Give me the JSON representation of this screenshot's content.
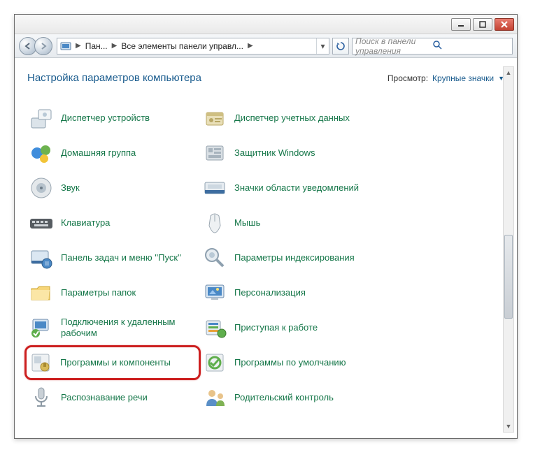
{
  "breadcrumb": {
    "seg1": "Пан...",
    "seg2": "Все элементы панели управл..."
  },
  "search": {
    "placeholder": "Поиск в панели управления"
  },
  "header": {
    "title": "Настройка параметров компьютера",
    "view_label": "Просмотр:",
    "view_value": "Крупные значки"
  },
  "left_items": [
    {
      "name": "device-manager",
      "label": "Диспетчер устройств",
      "icon": "device"
    },
    {
      "name": "homegroup",
      "label": "Домашняя группа",
      "icon": "homegroup"
    },
    {
      "name": "sound",
      "label": "Звук",
      "icon": "sound"
    },
    {
      "name": "keyboard",
      "label": "Клавиатура",
      "icon": "keyboard"
    },
    {
      "name": "taskbar-startmenu",
      "label": "Панель задач и меню ''Пуск''",
      "icon": "taskbar"
    },
    {
      "name": "folder-options",
      "label": "Параметры папок",
      "icon": "folder"
    },
    {
      "name": "remote-connections",
      "label": "Подключения к удаленным рабочим",
      "icon": "remote"
    },
    {
      "name": "programs-features",
      "label": "Программы и компоненты",
      "icon": "programs",
      "highlight": true
    },
    {
      "name": "speech-recognition",
      "label": "Распознавание речи",
      "icon": "mic"
    }
  ],
  "right_items": [
    {
      "name": "credential-manager",
      "label": "Диспетчер учетных данных",
      "icon": "cred"
    },
    {
      "name": "windows-defender",
      "label": "Защитник Windows",
      "icon": "defender"
    },
    {
      "name": "notification-icons",
      "label": "Значки области уведомлений",
      "icon": "tray"
    },
    {
      "name": "mouse",
      "label": "Мышь",
      "icon": "mouse"
    },
    {
      "name": "indexing-options",
      "label": "Параметры индексирования",
      "icon": "index"
    },
    {
      "name": "personalization",
      "label": "Персонализация",
      "icon": "personal"
    },
    {
      "name": "getting-started",
      "label": "Приступая к работе",
      "icon": "start"
    },
    {
      "name": "default-programs",
      "label": "Программы по умолчанию",
      "icon": "default"
    },
    {
      "name": "parental-controls",
      "label": "Родительский контроль",
      "icon": "parental"
    }
  ]
}
